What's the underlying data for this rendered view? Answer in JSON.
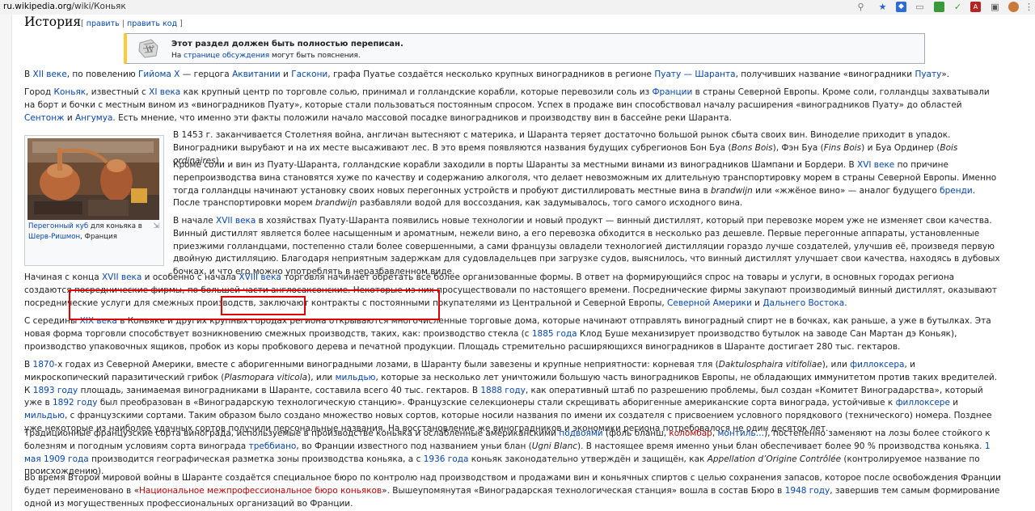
{
  "browser": {
    "url_host": "ru.wikipedia.org",
    "url_path": "/wiki/Коньяк"
  },
  "section": {
    "title": "История",
    "edit_open": "[",
    "edit_label": "править",
    "edit_sep": "|",
    "edit_code_label": "править код",
    "edit_close": "]"
  },
  "notice": {
    "title": "Этот раздел должен быть полностью переписан.",
    "text_before": "На ",
    "link": "странице обсуждения",
    "text_after": " могут быть пояснения."
  },
  "figure": {
    "caption_link1": "Перегонный куб",
    "caption_mid": " для коньяка в ",
    "caption_link2": "Шерв-Ришмон",
    "caption_end": ", Франция"
  },
  "colors": {
    "link": "#0645ad",
    "redlink": "#ba0000",
    "highlight_box": "#e00000",
    "ambox_accent": "#ffcc33"
  },
  "paragraphs": [
    [
      [
        "t",
        "В "
      ],
      [
        "a",
        "XII веке"
      ],
      [
        "t",
        ", по повелению "
      ],
      [
        "a",
        "Гийома X"
      ],
      [
        "t",
        " — герцога "
      ],
      [
        "a",
        "Аквитании"
      ],
      [
        "t",
        " и "
      ],
      [
        "a",
        "Гаскони"
      ],
      [
        "t",
        ", графа Пуатье создаётся несколько крупных виноградников в регионе "
      ],
      [
        "a",
        "Пуату — Шаранта"
      ],
      [
        "t",
        ", получивших название «виноградники "
      ],
      [
        "a",
        "Пуату"
      ],
      [
        "t",
        "»."
      ]
    ],
    [
      [
        "t",
        "Город "
      ],
      [
        "a",
        "Коньяк"
      ],
      [
        "t",
        ", известный с "
      ],
      [
        "a",
        "XI века"
      ],
      [
        "t",
        " как крупный центр по торговле солью, принимал и голландские корабли, которые перевозили соль из "
      ],
      [
        "a",
        "Франции"
      ],
      [
        "t",
        " в страны Северной Европы. Кроме соли, голландцы захватывали на борт и бочки с местным вином из «виноградников Пуату», которые стали пользоваться постоянным спросом. Успех в продаже вин способствовал началу расширения «виноградников Пуату» до областей "
      ],
      [
        "a",
        "Сентонж"
      ],
      [
        "t",
        " и "
      ],
      [
        "a",
        "Ангумуа"
      ],
      [
        "t",
        ". Есть мнение, что именно эти факты положили начало массовой посадке виноградников и производству вин в бассейне реки Шаранта."
      ]
    ],
    [
      [
        "t",
        "В 1453 г. заканчивается Столетняя война, англичан вытесняют с материка, и Шаранта теряет достаточно большой рынок сбыта своих вин. Виноделие приходит в упадок. Виноградники вырубают и на их месте высаживают лес. В это время появляются названия будущих субрегионов Бон Буа ("
      ],
      [
        "i",
        "Bons Bois"
      ],
      [
        "t",
        "), Фэн Буа ("
      ],
      [
        "i",
        "Fins Bois"
      ],
      [
        "t",
        ") и Буа Ординер ("
      ],
      [
        "i",
        "Bois ordinaires"
      ],
      [
        "t",
        ")."
      ]
    ],
    [
      [
        "t",
        "Кроме соли и вин из Пуату-Шаранта, голландские корабли заходили в порты Шаранты за местными винами из виноградников Шампани и Бордери. В "
      ],
      [
        "a",
        "XVI веке"
      ],
      [
        "t",
        " по причине перепроизводства вина становятся хуже по качеству и содержанию алкоголя, что делает невозможным их длительную транспортировку морем в страны Северной Европы. Именно тогда голландцы начинают установку своих новых перегонных устройств и пробуют дистиллировать местные вина в "
      ],
      [
        "i",
        "brandwijn"
      ],
      [
        "t",
        " или «жжёное вино» — аналог будущего "
      ],
      [
        "a",
        "бренди"
      ],
      [
        "t",
        ". После транспортировки морем "
      ],
      [
        "i",
        "brandwijn"
      ],
      [
        "t",
        " разбавляли водой для воссоздания, как задумывалось, того самого исходного вина."
      ]
    ],
    [
      [
        "t",
        "В начале "
      ],
      [
        "a",
        "XVII века"
      ],
      [
        "t",
        " в хозяйствах Пуату-Шаранта появились новые технологии и новый продукт — винный дистиллят, который при перевозке морем уже не изменяет свои качества. Винный дистиллят является более насыщенным и ароматным, нежели вино, а его перевозка обходится в несколько раз дешевле. Первые перегонные аппараты, установленные приезжими голландцами, постепенно стали более совершенными, а сами французы овладели технологией дистилляции гораздо лучше создателей, улучшив её, произведя первую двойную дистилляцию. Благодаря неприятным задержкам для судовладельцев при загрузке судов, выяснилось, что винный дистиллят улучшает свои качества, находясь в дубовых бочках, и что его можно употреблять в неразбавленном виде."
      ]
    ],
    [
      [
        "t",
        "Начиная с конца "
      ],
      [
        "a",
        "XVII века"
      ],
      [
        "t",
        " и особенно с начала "
      ],
      [
        "a",
        "XVIII века"
      ],
      [
        "t",
        " торговля начинает обретать всё более организованные формы. В ответ на формирующийся спрос на товары и услуги, в основных городах региона создаются посреднические фирмы, по большей части англосаксонские. Некоторые из них просуществовали по настоящего времени. Посреднические фирмы закупают производимый винный дистиллят, оказывают посреднические услуги для смежных производств, заключают контракты с постоянными покупателями из Центральной и Северной Европы, "
      ],
      [
        "a",
        "Северной Америки"
      ],
      [
        "t",
        " и "
      ],
      [
        "a",
        "Дальнего Востока"
      ],
      [
        "t",
        "."
      ]
    ],
    [
      [
        "t",
        "С середины "
      ],
      [
        "a",
        "XIX века"
      ],
      [
        "t",
        " в Коньяке и других крупных городах региона открываются многочисленные торговые дома, которые начинают отправлять виноградный спирт не в бочках, как раньше, а уже в бутылках. Эта новая форма торговли способствует возникновению смежных производств, таких, как: производство стекла (с "
      ],
      [
        "a",
        "1885 года"
      ],
      [
        "t",
        " Клод Буше механизирует производство бутылок на заводе Сан Мартан дэ Коньяк), производство упаковочных ящиков, пробок из коры пробкового дерева и печатной продукции. Площадь стремительно расширяющихся виноградников в Шаранте достигает 280 тыс. гектаров."
      ]
    ],
    [
      [
        "t",
        "В "
      ],
      [
        "a",
        "1870"
      ],
      [
        "t",
        "-х годах из Северной Америки, вместе с аборигенными виноградными лозами, в Шаранту были завезены и крупные неприятности: корневая тля ("
      ],
      [
        "i",
        "Daktulosphaira vitifoliae"
      ],
      [
        "t",
        "), или "
      ],
      [
        "a",
        "филлоксера"
      ],
      [
        "t",
        ", и микроскопический паразитический грибок ("
      ],
      [
        "i",
        "Plasmopara viticola"
      ],
      [
        "t",
        "), или "
      ],
      [
        "a",
        "мильдью"
      ],
      [
        "t",
        ", которые за несколько лет уничтожили большую часть виноградников Европы, не обладающих иммунитетом против таких вредителей. К "
      ],
      [
        "a",
        "1893 году"
      ],
      [
        "t",
        " площадь, занимаемая виноградниками в Шаранте, составила всего 40 тыс. гектаров. В "
      ],
      [
        "a",
        "1888 году"
      ],
      [
        "t",
        ", как оперативный штаб по разрешению проблемы, был создан «Комитет Виноградарства», который уже в "
      ],
      [
        "a",
        "1892 году"
      ],
      [
        "t",
        " был преобразован в «Виноградарскую технологическую станцию». Французские селекционеры стали скрещивать аборигенные американские сорта винограда, устойчивые к "
      ],
      [
        "a",
        "филлоксере"
      ],
      [
        "t",
        " и "
      ],
      [
        "a",
        "мильдью"
      ],
      [
        "t",
        ", с французскими сортами. Таким образом было создано множество новых сортов, которые носили названия по имени их создателя с присвоением условного порядкового (технического) номера. Позднее уже некоторые из наиболее удачных сортов получили персональные названия. На восстановление же виноградников и экономики региона потребовалося не один десяток лет."
      ]
    ],
    [
      [
        "t",
        "Традиционные французские сорта винограда, используемые в производстве коньяка и ослабленные американскими "
      ],
      [
        "a",
        "подвоями"
      ],
      [
        "t",
        " (фоль бланш, "
      ],
      [
        "r",
        "коломбар"
      ],
      [
        "t",
        ", "
      ],
      [
        "a",
        "монтиль…"
      ],
      [
        "t",
        "), постепенно заменяют на лозы более стойкого к болезням и погодным условиям сорта винограда "
      ],
      [
        "a",
        "треббиано"
      ],
      [
        "t",
        ", во Франции известного под названием уньи блан ("
      ],
      [
        "i",
        "Ugni Blanc"
      ],
      [
        "t",
        "). В настоящее время именно уньи блан обеспечивает более 90 % производства коньяка. "
      ],
      [
        "a",
        "1 мая"
      ],
      [
        "t",
        " "
      ],
      [
        "a",
        "1909 года"
      ],
      [
        "t",
        " производится географическая разметка зоны производства коньяка, а с "
      ],
      [
        "a",
        "1936 года"
      ],
      [
        "t",
        " коньяк законодательно утверждён и защищён, как "
      ],
      [
        "i",
        "Appellation d’Origine Contrôlée"
      ],
      [
        "t",
        " (контролируемое название по происхождению)."
      ]
    ],
    [
      [
        "t",
        "Во время Второй мировой войны в Шаранте создаётся специальное бюро по контролю над производством и продажами вин и коньячных спиртов с целью сохранения запасов, которое после освобождения Франции будет переименовано в «"
      ],
      [
        "r",
        "Национальное межпрофессиональное бюро коньяков"
      ],
      [
        "t",
        "». Вышеупомянутая «Виноградарская технологическая станция» вошла в состав Бюро в "
      ],
      [
        "a",
        "1948 году"
      ],
      [
        "t",
        ", завершив тем самым формирование одной из могущественных профессиональных организаций во Франции."
      ]
    ]
  ]
}
